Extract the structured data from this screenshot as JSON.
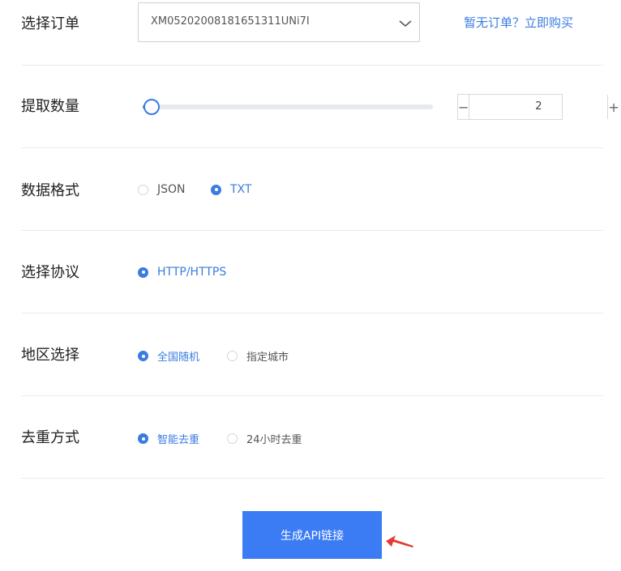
{
  "order": {
    "label": "选择订单",
    "selected": "XM05202008181651311UNi7I",
    "buy_link": "暂无订单？立即购买"
  },
  "quantity": {
    "label": "提取数量",
    "value": "2",
    "slider_fraction": 0.02,
    "minus": "−",
    "plus": "+"
  },
  "format": {
    "label": "数据格式",
    "options": [
      {
        "label": "JSON",
        "selected": false
      },
      {
        "label": "TXT",
        "selected": true
      }
    ]
  },
  "protocol": {
    "label": "选择协议",
    "options": [
      {
        "label": "HTTP/HTTPS",
        "selected": true
      }
    ]
  },
  "region": {
    "label": "地区选择",
    "options": [
      {
        "label": "全国随机",
        "selected": true
      },
      {
        "label": "指定城市",
        "selected": false
      }
    ]
  },
  "dedup": {
    "label": "去重方式",
    "options": [
      {
        "label": "智能去重",
        "selected": true
      },
      {
        "label": "24小时去重",
        "selected": false
      }
    ]
  },
  "generate_button": "生成API链接",
  "colors": {
    "accent": "#3a7ce2",
    "button": "#3b7cf4",
    "arrow": "#e53935"
  }
}
